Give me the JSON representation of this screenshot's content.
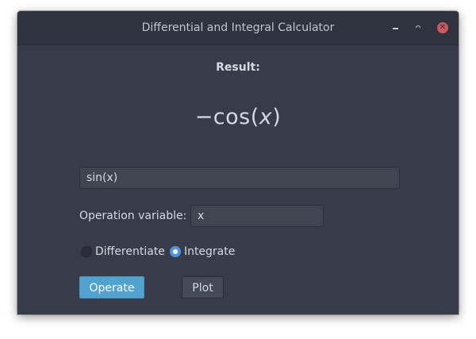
{
  "window": {
    "title": "Differential and Integral Calculator",
    "controls": {
      "minimize_icon": "minimize-icon",
      "maximize_icon": "maximize-icon",
      "close_icon": "close-icon",
      "close_glyph": "✕",
      "close_color": "#cc575d"
    }
  },
  "result": {
    "label": "Result:",
    "prefix": "−cos(",
    "variable": "x",
    "suffix": ")"
  },
  "expression": {
    "value": "sin(x)"
  },
  "operation_variable": {
    "label": "Operation variable:",
    "value": "x"
  },
  "mode": {
    "options": [
      {
        "label": "Differentiate",
        "selected": false
      },
      {
        "label": "Integrate",
        "selected": true
      }
    ]
  },
  "buttons": {
    "operate": "Operate",
    "plot": "Plot"
  },
  "colors": {
    "window_bg": "#383c4a",
    "titlebar_bg": "#2f333d",
    "accent": "#50a3cf",
    "radio_selected": "#5294e2"
  }
}
